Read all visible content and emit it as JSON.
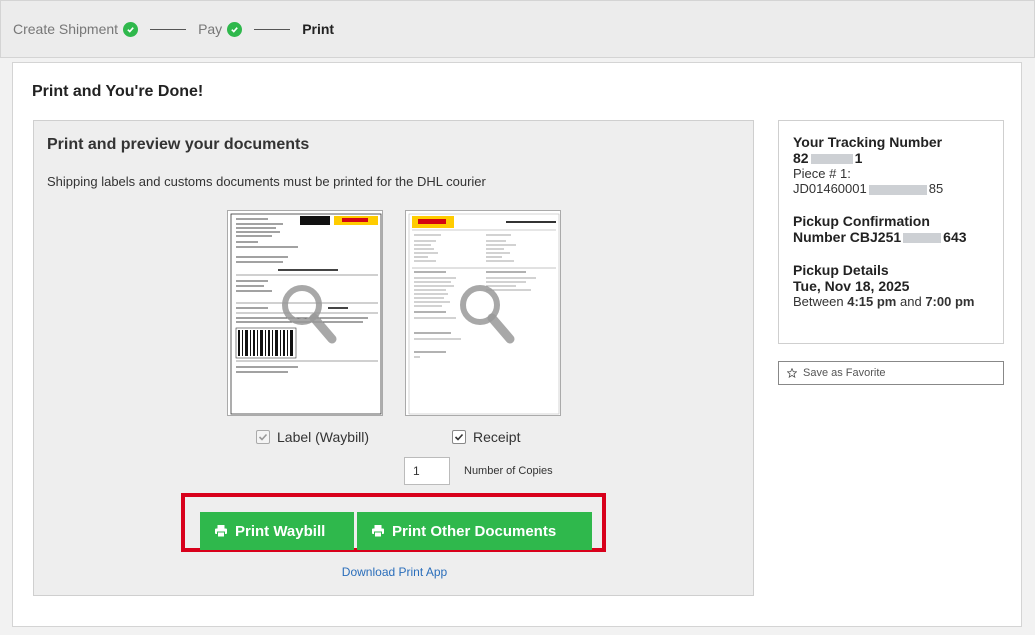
{
  "progress": {
    "steps": [
      {
        "label": "Create Shipment",
        "done": true
      },
      {
        "label": "Pay",
        "done": true
      },
      {
        "label": "Print",
        "done": false
      }
    ]
  },
  "page_title": "Print and You're Done!",
  "documents": {
    "title": "Print and preview your documents",
    "description": "Shipping labels and customs documents must be printed for the DHL courier",
    "options": [
      {
        "label": "Label (Waybill)",
        "checked": true,
        "disabled": true
      },
      {
        "label": "Receipt",
        "checked": true,
        "disabled": false
      }
    ],
    "copies_value": "1",
    "copies_label": "Number of Copies",
    "print_waybill_label": "Print Waybill",
    "print_other_label": "Print Other Documents",
    "download_link": "Download Print App",
    "accent": "#2fb84c",
    "highlight": "#d8001b"
  },
  "tracking": {
    "heading1": "Your Tracking Number",
    "number_start": "82",
    "number_end": "1",
    "piece_label": "Piece # 1:",
    "piece_start": "JD01460001",
    "piece_end": "85",
    "pickup_conf_heading": "Pickup Confirmation",
    "pickup_conf_prefix": "Number CBJ251",
    "pickup_conf_end": "643",
    "pickup_details_heading": "Pickup Details",
    "pickup_date": "Tue, Nov 18, 2025",
    "between": "Between",
    "time_start": "4:15 pm",
    "and": "and",
    "time_end": "7:00 pm"
  },
  "favorite_label": "Save as Favorite"
}
